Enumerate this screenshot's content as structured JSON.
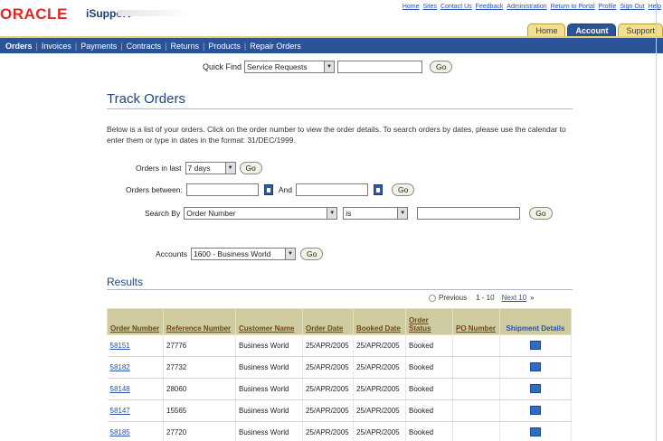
{
  "header": {
    "logo": "ORACLE",
    "logo_sub": "iSupport",
    "global_links": [
      "Home",
      "Sites",
      "Contact Us",
      "Feedback",
      "Administration",
      "Return to Portal",
      "Profile",
      "Sign Out",
      "Help"
    ]
  },
  "tabs": [
    {
      "label": "Home",
      "active": false
    },
    {
      "label": "Account",
      "active": true
    },
    {
      "label": "Support",
      "active": false
    }
  ],
  "nav": [
    "Orders",
    "Invoices",
    "Payments",
    "Contracts",
    "Returns",
    "Products",
    "Repair Orders"
  ],
  "quick_find": {
    "label": "Quick Find",
    "selected": "Service Requests",
    "go": "Go"
  },
  "page_title": "Track Orders",
  "intro": "Below is a list of your orders. Click on the order number to view the order details. To search orders by dates, please use the calendar to enter them or type in dates in the format: 31/DEC/1999.",
  "filters": {
    "orders_last_label": "Orders in last",
    "orders_last_value": "7 days",
    "between_label": "Orders between:",
    "and_label": "And",
    "search_by_label": "Search By",
    "search_by_value": "Order Number",
    "operator_value": "is",
    "accounts_label": "Accounts",
    "accounts_value": "1600 - Business World",
    "go": "Go"
  },
  "results": {
    "title": "Results",
    "pager": {
      "previous": "Previous",
      "range": "1 - 10",
      "next": "Next 10"
    },
    "columns": [
      "Order Number",
      "Reference Number",
      "Customer Name",
      "Order Date",
      "Booked Date",
      "Order Status",
      "PO Number",
      "Shipment Details"
    ],
    "rows": [
      {
        "order": "58151",
        "ref": "27776",
        "customer": "Business World",
        "order_date": "25/APR/2005",
        "booked_date": "25/APR/2005",
        "status": "Booked",
        "po": ""
      },
      {
        "order": "58182",
        "ref": "27732",
        "customer": "Business World",
        "order_date": "25/APR/2005",
        "booked_date": "25/APR/2005",
        "status": "Booked",
        "po": ""
      },
      {
        "order": "58148",
        "ref": "28060",
        "customer": "Business World",
        "order_date": "25/APR/2005",
        "booked_date": "25/APR/2005",
        "status": "Booked",
        "po": ""
      },
      {
        "order": "58147",
        "ref": "15565",
        "customer": "Business World",
        "order_date": "25/APR/2005",
        "booked_date": "25/APR/2005",
        "status": "Booked",
        "po": ""
      },
      {
        "order": "58185",
        "ref": "27720",
        "customer": "Business World",
        "order_date": "25/APR/2005",
        "booked_date": "25/APR/2005",
        "status": "Booked",
        "po": ""
      }
    ]
  },
  "colors": {
    "brand_red": "#e8251f",
    "nav_blue": "#2c5396",
    "header_tan": "#cfcba0"
  }
}
